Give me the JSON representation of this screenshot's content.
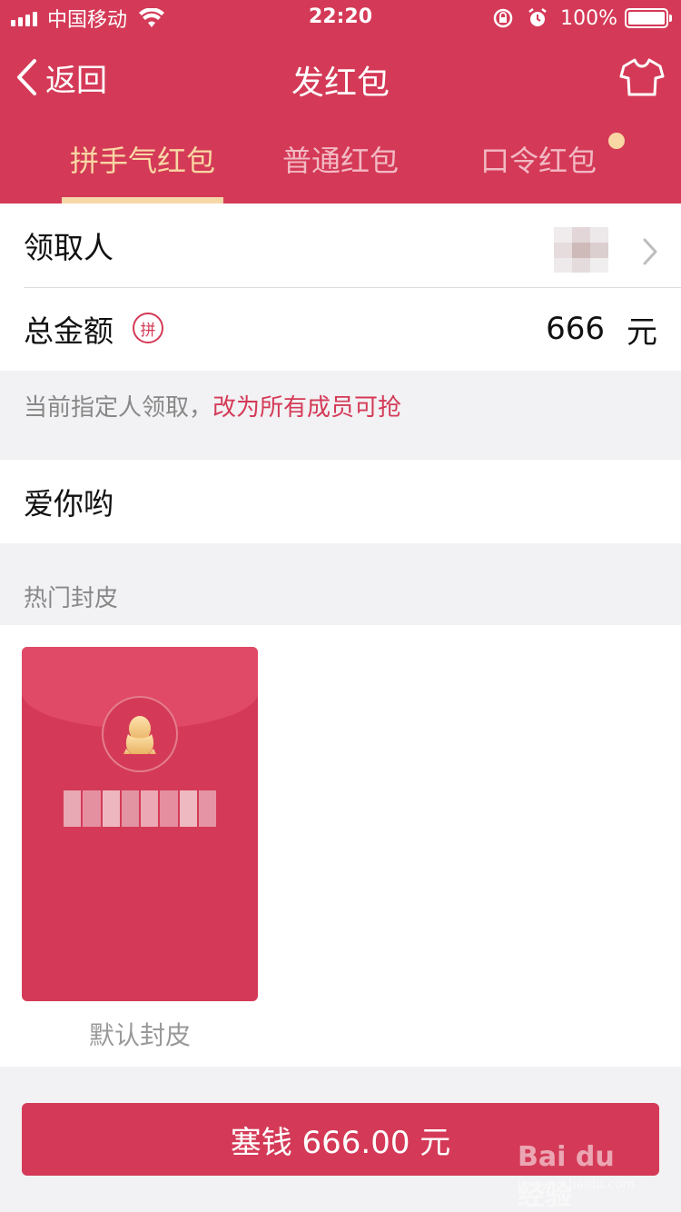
{
  "status_bar": {
    "carrier": "中国移动",
    "time": "22:20",
    "battery": "100%"
  },
  "nav": {
    "back_label": "返回",
    "title": "发红包"
  },
  "tabs": [
    {
      "label": "拼手气红包",
      "active": true
    },
    {
      "label": "普通红包",
      "active": false
    },
    {
      "label": "口令红包",
      "active": false
    }
  ],
  "form": {
    "recipient_label": "领取人",
    "total_label": "总金额",
    "pin_badge": "拼",
    "amount": "666",
    "unit": "元",
    "hint_prefix": "当前指定人领取，",
    "hint_link": "改为所有成员可抢",
    "message": "爱你哟"
  },
  "covers": {
    "section_title": "热门封皮",
    "default_caption": "默认封皮"
  },
  "submit": {
    "label": "塞钱 666.00 元"
  },
  "watermark": {
    "main": "Bai du 经验",
    "sub": "jingyan.baidu.com"
  },
  "colors": {
    "brand_red": "#d43a57",
    "active_tab": "#f9d7a4"
  }
}
